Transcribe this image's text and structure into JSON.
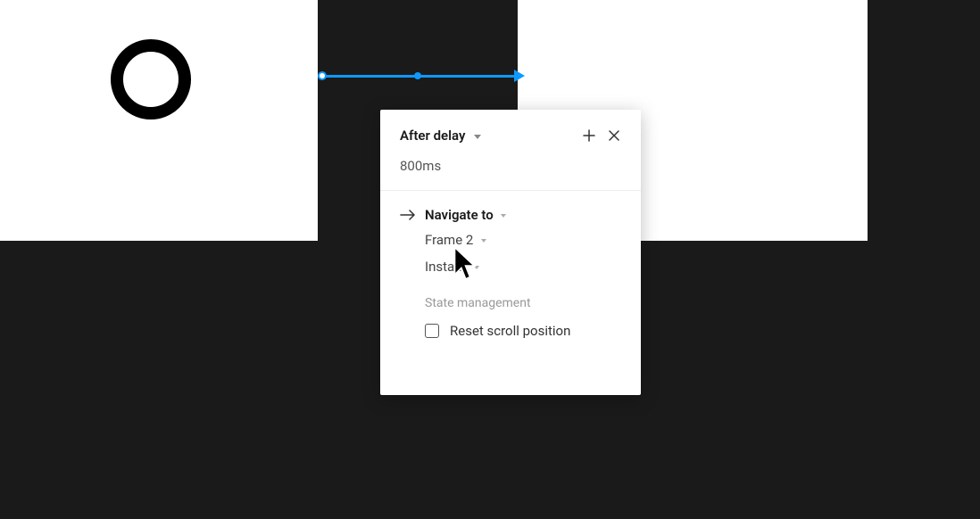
{
  "trigger": {
    "type": "After delay",
    "delay": "800ms"
  },
  "action": {
    "type": "Navigate to",
    "destination": "Frame 2",
    "animation": "Instant"
  },
  "state": {
    "section_label": "State management",
    "reset_scroll": {
      "label": "Reset scroll position",
      "checked": false
    }
  }
}
